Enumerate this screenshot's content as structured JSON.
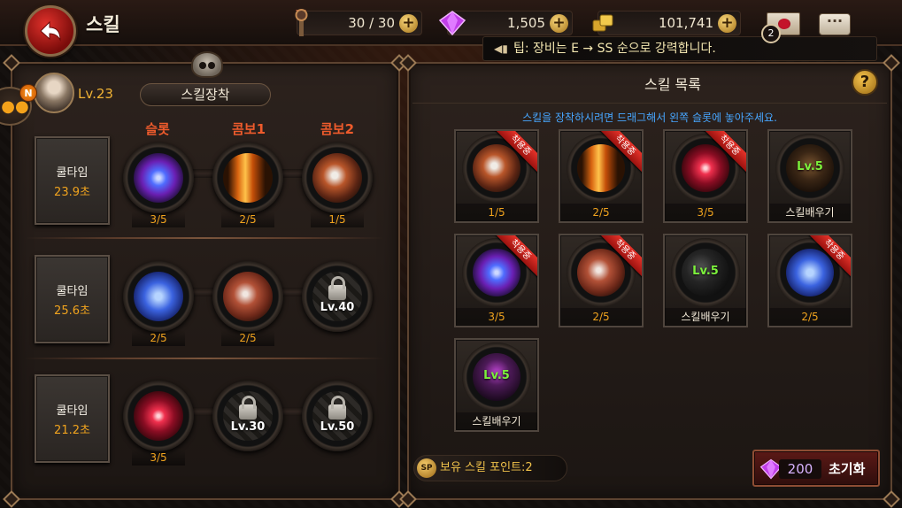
{
  "header": {
    "back_icon": "back-arrow-icon",
    "title": "스킬",
    "stamina": "30 / 30",
    "gems": "1,505",
    "gold": "101,741",
    "mail_badge": "2",
    "chat_icon": "chat-icon"
  },
  "tip": {
    "text": "팁: 장비는 E → SS 순으로 강력합니다."
  },
  "left_panel": {
    "notification_badge": "N",
    "level": "Lv.23",
    "title": "스킬장착",
    "columns": [
      "슬롯",
      "콤보1",
      "콤보2"
    ],
    "rows": [
      {
        "cooldown_label": "쿨타임",
        "cooldown_value": "23.9초",
        "slots": [
          {
            "count": "3/5",
            "icon": "purple-vortex-skill"
          },
          {
            "count": "2/5",
            "icon": "flame-pillar-skill"
          },
          {
            "count": "1/5",
            "icon": "claw-slash-skill"
          }
        ]
      },
      {
        "cooldown_label": "쿨타임",
        "cooldown_value": "25.6초",
        "slots": [
          {
            "count": "2/5",
            "icon": "blue-storm-skill"
          },
          {
            "count": "2/5",
            "icon": "blade-slash-skill"
          },
          {
            "locked": true,
            "lock_level": "Lv.40"
          }
        ]
      },
      {
        "cooldown_label": "쿨타임",
        "cooldown_value": "21.2초",
        "slots": [
          {
            "count": "3/5",
            "icon": "red-burst-skill"
          },
          {
            "locked": true,
            "lock_level": "Lv.30"
          },
          {
            "locked": true,
            "lock_level": "Lv.50"
          }
        ]
      }
    ]
  },
  "right_panel": {
    "title": "스킬 목록",
    "help": "?",
    "hint": "스킬을 장착하시려면 드래그해서 왼쪽 슬롯에 놓아주세요.",
    "equipped_ribbon": "착용중",
    "learn_label": "스킬배우기",
    "cards": [
      {
        "equipped": true,
        "footer": "1/5",
        "icon": "claw-slash-skill"
      },
      {
        "equipped": true,
        "footer": "2/5",
        "icon": "flame-pillar-skill"
      },
      {
        "equipped": true,
        "footer": "3/5",
        "icon": "red-burst-skill"
      },
      {
        "equipped": false,
        "level": "Lv.5",
        "footer": "스킬배우기",
        "icon": "dark-skill"
      },
      {
        "equipped": true,
        "footer": "3/5",
        "icon": "purple-vortex-skill"
      },
      {
        "equipped": true,
        "footer": "2/5",
        "icon": "blade-slash-skill"
      },
      {
        "equipped": false,
        "level": "Lv.5",
        "footer": "스킬배우기",
        "icon": "dark-wing-skill"
      },
      {
        "equipped": true,
        "footer": "2/5",
        "icon": "blue-storm-skill"
      },
      {
        "equipped": false,
        "level": "Lv.5",
        "footer": "스킬배우기",
        "icon": "shadow-skill"
      }
    ],
    "skill_points_icon": "SP",
    "skill_points": "보유 스킬 포인트:2",
    "reset_cost": "200",
    "reset_label": "초기화"
  },
  "colors": {
    "accent_orange": "#f0a31e",
    "combo_label_red": "#ee5b2c",
    "hint_blue": "#47a6ff",
    "learn_level_green": "#7cf03c"
  }
}
